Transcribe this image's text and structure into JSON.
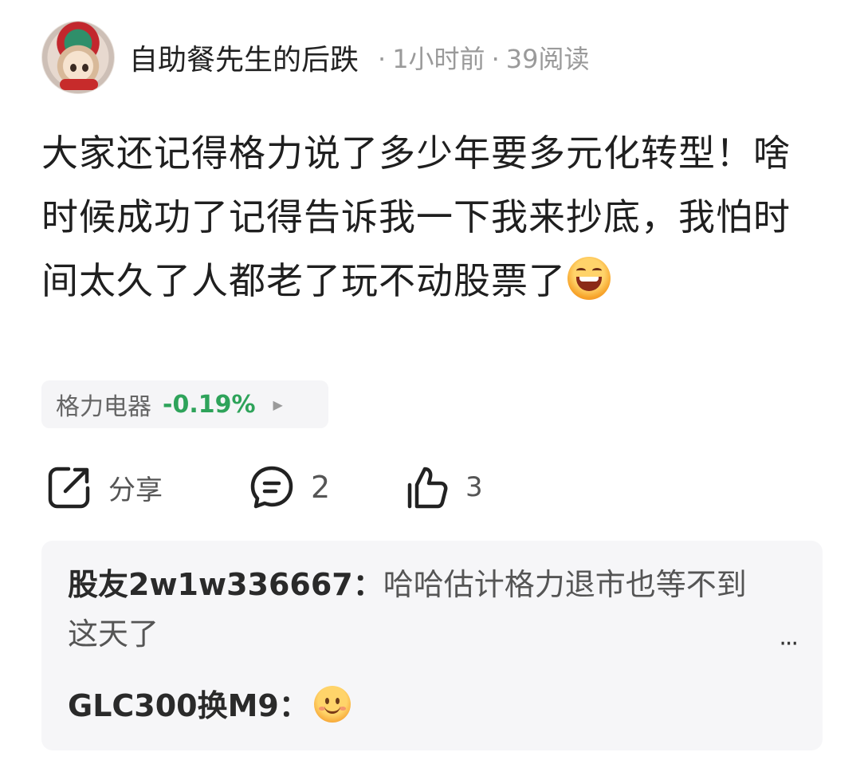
{
  "header": {
    "author": "自助餐先生的后跌",
    "time": "1小时前",
    "reads": "39阅读",
    "separator": "·"
  },
  "post": {
    "text": "大家还记得格力说了多少年要多元化转型！啥时候成功了记得告诉我一下我来抄底，我怕时间太久了人都老了玩不动股票了",
    "emoji": "laughing-emoji"
  },
  "stock": {
    "name": "格力电器",
    "change": "-0.19%",
    "change_color": "#2ea35a",
    "arrow": "▶"
  },
  "actions": {
    "share_label": "分享",
    "comment_count": "2",
    "like_count": "3"
  },
  "comments": [
    {
      "user": "股友2w1w336667",
      "sep": "：",
      "text": "哈哈估计格力退市也等不到这天了"
    },
    {
      "user": "GLC300换M9",
      "sep": "：",
      "text": "",
      "emoji": "smiling-emoji"
    }
  ],
  "more_label": "···"
}
